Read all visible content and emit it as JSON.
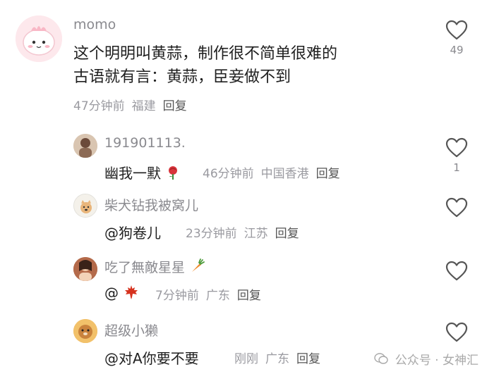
{
  "comments": {
    "main": {
      "username": "momo",
      "text_line1": "这个明明叫黄蒜，制作很不简单很难的",
      "text_line2": "古语就有言：黄蒜，臣妾做不到",
      "time": "47分钟前",
      "location": "福建",
      "reply_label": "回复",
      "like_count": "49",
      "avatar_icon": "pink-cartoon-avatar"
    },
    "replies": [
      {
        "username": "191901113.",
        "text": "幽我一默",
        "emoji": "rose-icon",
        "time": "46分钟前",
        "location": "中国香港",
        "reply_label": "回复",
        "like_count": "1"
      },
      {
        "username": "柴犬钻我被窝儿",
        "text": "@狗卷儿",
        "time": "23分钟前",
        "location": "江苏",
        "reply_label": "回复",
        "like_count": ""
      },
      {
        "username": "吃了無敵星星",
        "username_emoji": "carrot-icon",
        "text": "@",
        "emoji": "maple-leaf-icon",
        "time": "7分钟前",
        "location": "广东",
        "reply_label": "回复",
        "like_count": ""
      },
      {
        "username": "超级小獭",
        "text": "@对A你要不要",
        "time": "刚刚",
        "location": "广东",
        "reply_label": "回复",
        "like_count": ""
      }
    ]
  },
  "watermark": {
    "text": "公众号 · 女神汇"
  },
  "colors": {
    "username": "#8a8a8f",
    "meta": "#9a9aa0",
    "heart_outline": "#555555"
  }
}
